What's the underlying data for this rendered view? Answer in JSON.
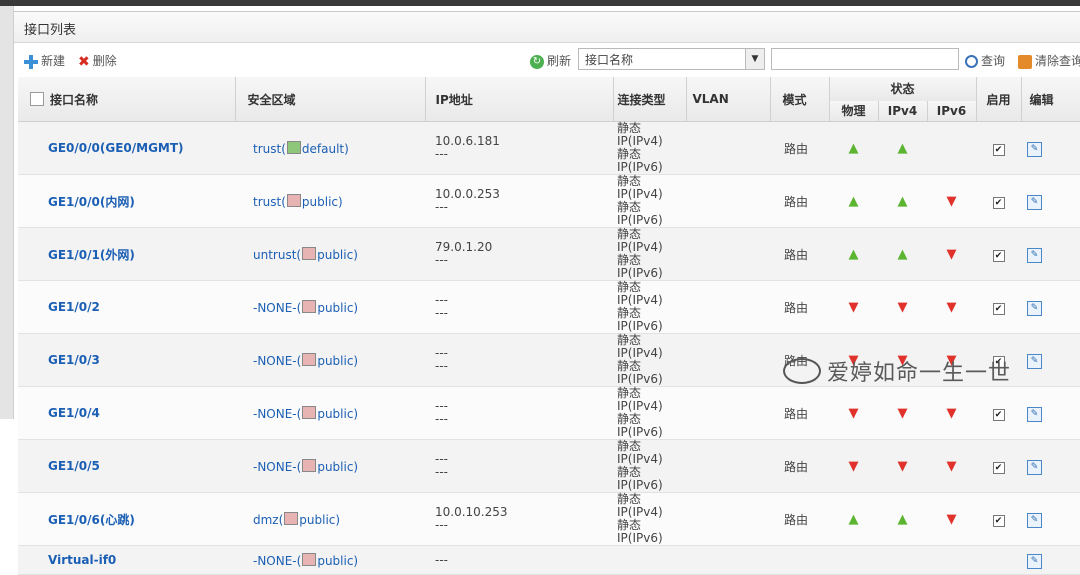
{
  "panel": {
    "title": "接口列表"
  },
  "toolbar": {
    "new_label": "新建",
    "delete_label": "删除",
    "refresh_label": "刷新",
    "filter_select_value": "接口名称",
    "search_value": "",
    "query_label": "查询",
    "clear_label": "清除查询"
  },
  "headers": {
    "name": "接口名称",
    "zone": "安全区域",
    "ip": "IP地址",
    "type": "连接类型",
    "vlan": "VLAN",
    "mode": "模式",
    "status": "状态",
    "phys": "物理",
    "ipv4": "IPv4",
    "ipv6": "IPv6",
    "enable": "启用",
    "edit": "编辑"
  },
  "rows": [
    {
      "name": "GE0/0/0(GE0/MGMT)",
      "zone_a": "trust(",
      "zone_b": "default)",
      "zone_icon": "green",
      "ip1": "10.0.6.181",
      "ip2": "---",
      "type1": "静态IP(IPv4)",
      "type2": "静态IP(IPv6)",
      "mode": "路由",
      "phys": "up",
      "ipv4": "up",
      "ipv6": ""
    },
    {
      "name": "GE1/0/0(内网)",
      "zone_a": "trust(",
      "zone_b": "public)",
      "zone_icon": "red",
      "ip1": "10.0.0.253",
      "ip2": "---",
      "type1": "静态IP(IPv4)",
      "type2": "静态IP(IPv6)",
      "mode": "路由",
      "phys": "up",
      "ipv4": "up",
      "ipv6": "down"
    },
    {
      "name": "GE1/0/1(外网)",
      "zone_a": "untrust(",
      "zone_b": "public)",
      "zone_icon": "red",
      "ip1": "79.0.1.20",
      "ip2": "---",
      "type1": "静态IP(IPv4)",
      "type2": "静态IP(IPv6)",
      "mode": "路由",
      "phys": "up",
      "ipv4": "up",
      "ipv6": "down"
    },
    {
      "name": "GE1/0/2",
      "zone_a": "-NONE-(",
      "zone_b": "public)",
      "zone_icon": "red",
      "ip1": "---",
      "ip2": "---",
      "type1": "静态IP(IPv4)",
      "type2": "静态IP(IPv6)",
      "mode": "路由",
      "phys": "down",
      "ipv4": "down",
      "ipv6": "down"
    },
    {
      "name": "GE1/0/3",
      "zone_a": "-NONE-(",
      "zone_b": "public)",
      "zone_icon": "red",
      "ip1": "---",
      "ip2": "---",
      "type1": "静态IP(IPv4)",
      "type2": "静态IP(IPv6)",
      "mode": "路由",
      "phys": "down",
      "ipv4": "down",
      "ipv6": "down"
    },
    {
      "name": "GE1/0/4",
      "zone_a": "-NONE-(",
      "zone_b": "public)",
      "zone_icon": "red",
      "ip1": "---",
      "ip2": "---",
      "type1": "静态IP(IPv4)",
      "type2": "静态IP(IPv6)",
      "mode": "路由",
      "phys": "down",
      "ipv4": "down",
      "ipv6": "down"
    },
    {
      "name": "GE1/0/5",
      "zone_a": "-NONE-(",
      "zone_b": "public)",
      "zone_icon": "red",
      "ip1": "---",
      "ip2": "---",
      "type1": "静态IP(IPv4)",
      "type2": "静态IP(IPv6)",
      "mode": "路由",
      "phys": "down",
      "ipv4": "down",
      "ipv6": "down"
    },
    {
      "name": "GE1/0/6(心跳)",
      "zone_a": "dmz(",
      "zone_b": "public)",
      "zone_icon": "red",
      "ip1": "10.0.10.253",
      "ip2": "---",
      "type1": "静态IP(IPv4)",
      "type2": "静态IP(IPv6)",
      "mode": "路由",
      "phys": "up",
      "ipv4": "up",
      "ipv6": "down"
    },
    {
      "name": "Virtual-if0",
      "zone_a": "-NONE-(",
      "zone_b": "public)",
      "zone_icon": "red",
      "ip1": "---",
      "ip2": "",
      "type1": "",
      "type2": "",
      "mode": "",
      "phys": "",
      "ipv4": "",
      "ipv6": ""
    }
  ],
  "icons": {
    "up": "▲",
    "down": "▼",
    "check": "✔",
    "edit": "✎"
  },
  "watermark": {
    "text": "爱婷如命一生一世"
  }
}
